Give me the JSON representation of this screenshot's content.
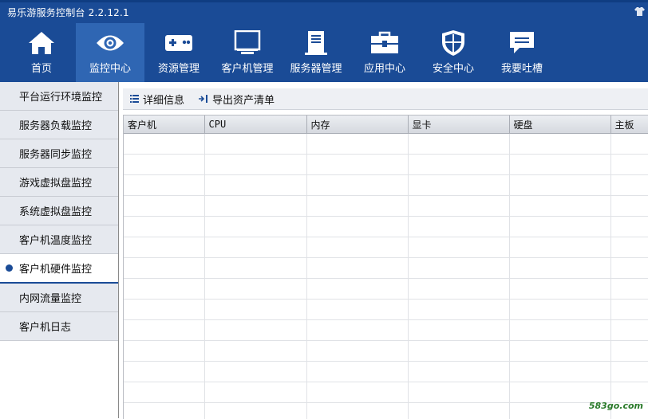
{
  "app": {
    "title": "易乐游服务控制台 2.2.12.1"
  },
  "nav": [
    {
      "label": "首页",
      "icon": "home-icon"
    },
    {
      "label": "监控中心",
      "icon": "eye-icon",
      "active": true
    },
    {
      "label": "资源管理",
      "icon": "gamepad-icon"
    },
    {
      "label": "客户机管理",
      "icon": "monitor-icon"
    },
    {
      "label": "服务器管理",
      "icon": "server-icon"
    },
    {
      "label": "应用中心",
      "icon": "toolbox-icon"
    },
    {
      "label": "安全中心",
      "icon": "shield-icon"
    },
    {
      "label": "我要吐槽",
      "icon": "feedback-icon"
    }
  ],
  "sidebar": {
    "items": [
      {
        "label": "平台运行环境监控"
      },
      {
        "label": "服务器负载监控"
      },
      {
        "label": "服务器同步监控"
      },
      {
        "label": "游戏虚拟盘监控"
      },
      {
        "label": "系统虚拟盘监控"
      },
      {
        "label": "客户机温度监控"
      },
      {
        "label": "客户机硬件监控",
        "active": true
      },
      {
        "label": "内网流量监控"
      },
      {
        "label": "客户机日志"
      }
    ]
  },
  "toolbar": {
    "details_label": "详细信息",
    "export_label": "导出资产清单"
  },
  "table": {
    "columns": [
      "客户机",
      "CPU",
      "内存",
      "显卡",
      "硬盘",
      "主板"
    ],
    "rows": []
  },
  "watermark": "583go.com",
  "colors": {
    "brand": "#1a4b96",
    "active_nav": "#2f66b3"
  }
}
